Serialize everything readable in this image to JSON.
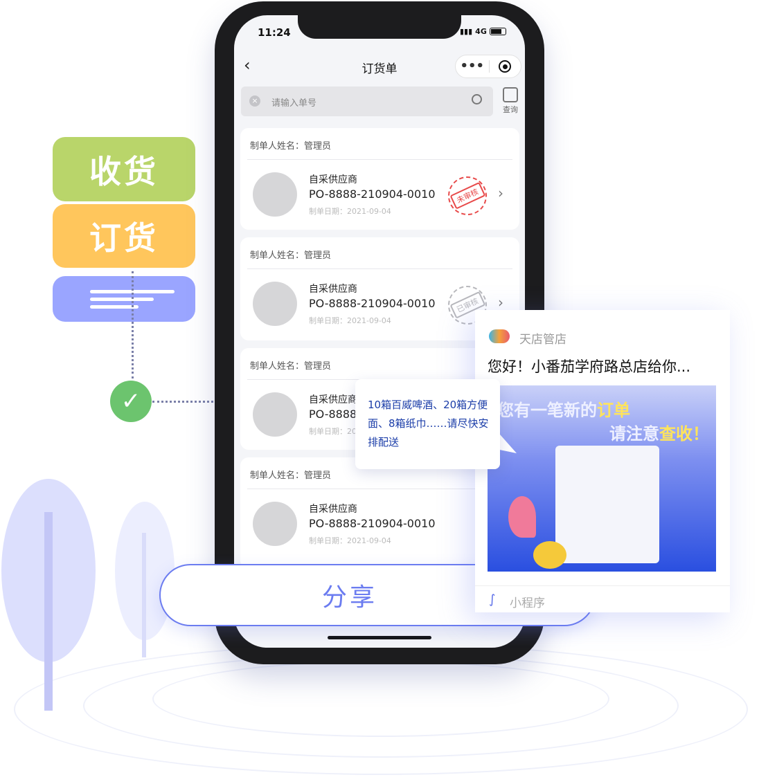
{
  "tags": [
    {
      "label": "收货",
      "color": "#b9d56a"
    },
    {
      "label": "订货",
      "color": "#ffc65c"
    },
    {
      "label": "",
      "color": "#9aa5ff"
    }
  ],
  "status_bar": {
    "time": "11:24",
    "network": "4G"
  },
  "nav": {
    "title": "订货单",
    "back_icon": "chevron-left-icon",
    "more_icon": "more-dots-icon",
    "target_icon": "target-icon"
  },
  "search": {
    "placeholder": "请输入单号",
    "query_label": "查询"
  },
  "orders": [
    {
      "creator": "制单人姓名：管理员",
      "supplier": "自采供应商",
      "po": "PO-8888-210904-0010",
      "date": "制单日期：2021-09-04",
      "stamp": "未审核",
      "stamp_color": "#e84a4a"
    },
    {
      "creator": "制单人姓名：管理员",
      "supplier": "自采供应商",
      "po": "PO-8888-210904-0010",
      "date": "制单日期：2021-09-04",
      "stamp": "已审核",
      "stamp_color": "#b8b8bc"
    },
    {
      "creator": "制单人姓名：管理员",
      "supplier": "自采供应商",
      "po": "PO-8888-210904-0010",
      "date": "制单日期：2021-09-04",
      "stamp": "",
      "stamp_color": ""
    },
    {
      "creator": "制单人姓名：管理员",
      "supplier": "自采供应商",
      "po": "PO-8888-210904-0010",
      "date": "制单日期：2021-09-04",
      "stamp": "",
      "stamp_color": ""
    }
  ],
  "share_button": {
    "label": "分享",
    "color": "#6b7cf0"
  },
  "bubble": {
    "text": "10箱百威啤酒、20箱方便面、8箱纸巾……请尽快安排配送"
  },
  "share_card": {
    "app_name": "天店管店",
    "title": "您好！小番茄学府路总店给你...",
    "banner_line1": "您有一笔新的",
    "banner_hl1": "订单",
    "banner_line2": "请注意",
    "banner_hl2": "查收！",
    "footer": "小程序"
  }
}
